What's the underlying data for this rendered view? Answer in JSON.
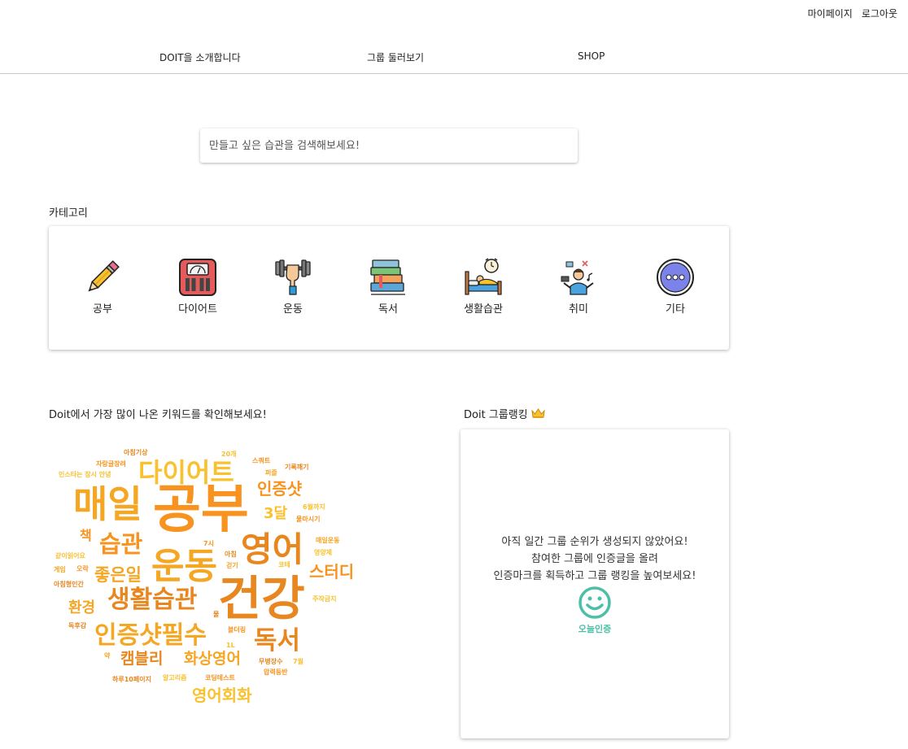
{
  "topbar": {
    "mypage": "마이페이지",
    "logout": "로그아웃"
  },
  "nav": {
    "about": "DOIT을 소개합니다",
    "groups": "그룹 둘러보기",
    "shop": "SHOP"
  },
  "search": {
    "placeholder": "만들고 싶은 습관을 검색해보세요!"
  },
  "category": {
    "title": "카테고리",
    "items": [
      {
        "label": "공부",
        "icon": "pencil-icon"
      },
      {
        "label": "다이어트",
        "icon": "scale-icon"
      },
      {
        "label": "운동",
        "icon": "dumbbell-icon"
      },
      {
        "label": "독서",
        "icon": "books-icon"
      },
      {
        "label": "생활습관",
        "icon": "bed-alarm-icon"
      },
      {
        "label": "취미",
        "icon": "hobby-icon"
      },
      {
        "label": "기타",
        "icon": "more-icon"
      }
    ]
  },
  "keywords": {
    "title": "Doit에서 가장 많이 나온 키워드를 확인해보세요!",
    "words": [
      "공부",
      "매일",
      "건강",
      "다이어트",
      "영어",
      "운동",
      "생활습관",
      "인증샷필수",
      "습관",
      "독서",
      "좋은일",
      "인증샷",
      "3달",
      "스터디",
      "환경",
      "캠블리",
      "화상영어",
      "영어회화",
      "책",
      "아침기상",
      "20개",
      "스쿼트",
      "기록깨기",
      "자랑글장려",
      "인스타는 잠시 안녕",
      "퍼즐",
      "6월까지",
      "물마시기",
      "매일운동",
      "영양제",
      "7시",
      "아침",
      "코테",
      "걷기",
      "같이읽어요",
      "게임",
      "오락",
      "아침형인간",
      "주작금지",
      "물",
      "블더링",
      "독후감",
      "1L",
      "무병장수",
      "7월",
      "약",
      "압력등반",
      "하루10페이지",
      "알고리즘",
      "코딩테스트"
    ]
  },
  "ranking": {
    "title": "Doit 그룹랭킹",
    "crown": "crown-icon",
    "messages": [
      "아직 일간 그룹 순위가 생성되지 않았어요!",
      "참여한 그룹에 인증글을 올려",
      "인증마크를 획득하고 그룹 랭킹을 높여보세요!"
    ],
    "today_label": "오늘인증"
  },
  "colors": {
    "accent_orange": "#f7931e",
    "accent_yellow": "#f8c12d",
    "teal": "#4dbfa8"
  }
}
